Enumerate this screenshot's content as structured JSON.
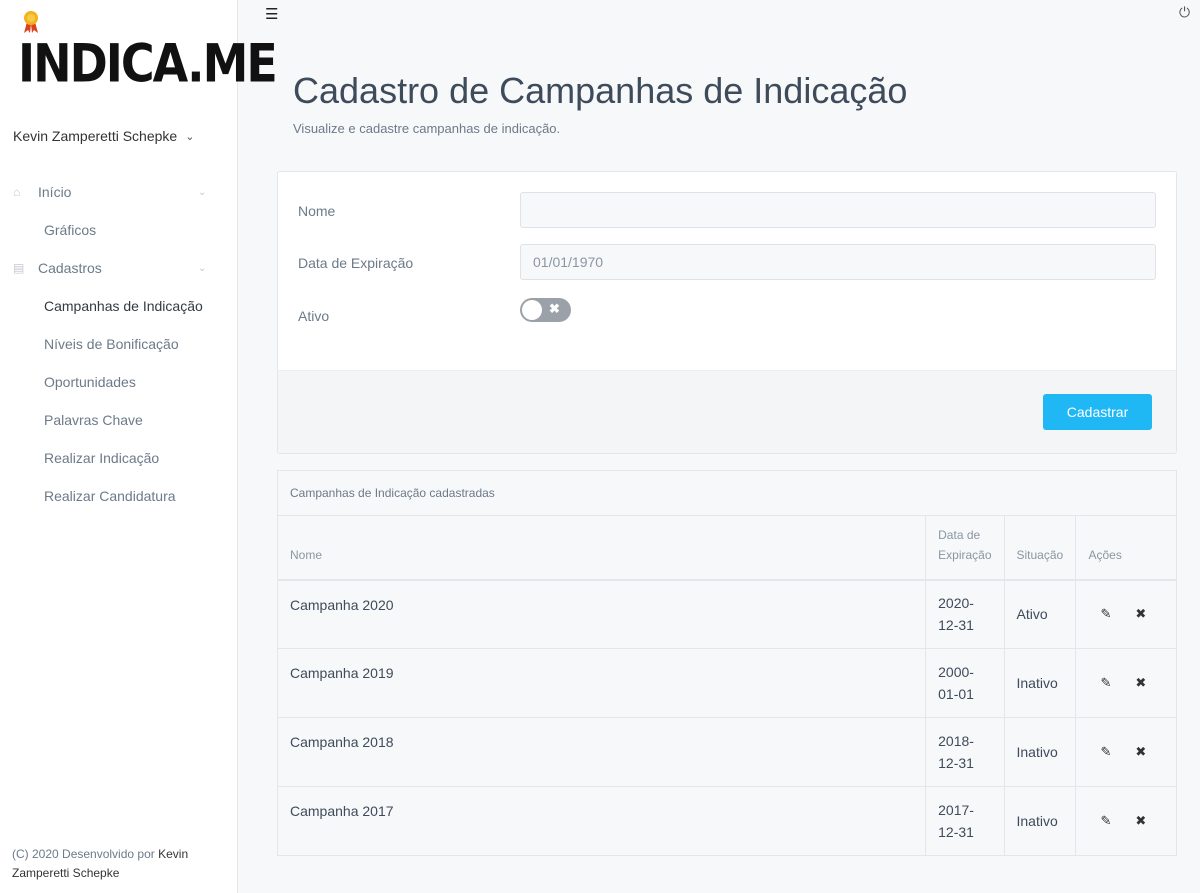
{
  "brand": {
    "logo_text": "INDICA.ME"
  },
  "user": {
    "name": "Kevin Zamperetti Schepke"
  },
  "sidebar": {
    "items": [
      {
        "label": "Início",
        "icon": "home-icon"
      },
      {
        "label": "Gráficos"
      },
      {
        "label": "Cadastros",
        "icon": "archive-icon"
      },
      {
        "label": "Campanhas de Indicação"
      },
      {
        "label": "Níveis de Bonificação"
      },
      {
        "label": "Oportunidades"
      },
      {
        "label": "Palavras Chave"
      },
      {
        "label": "Realizar Indicação"
      },
      {
        "label": "Realizar Candidatura"
      }
    ]
  },
  "footer": {
    "prefix": "(C) 2020 Desenvolvido por",
    "author": "Kevin Zamperetti Schepke"
  },
  "header": {
    "title": "Cadastro de Campanhas de Indicação",
    "subtitle": "Visualize e cadastre campanhas de indicação."
  },
  "form": {
    "name_label": "Nome",
    "name_value": "",
    "expiration_label": "Data de Expiração",
    "expiration_value": "01/01/1970",
    "active_label": "Ativo",
    "active": false,
    "submit_label": "Cadastrar"
  },
  "table": {
    "caption": "Campanhas de Indicação cadastradas",
    "columns": [
      "Nome",
      "Data de Expiração",
      "Situação",
      "Ações"
    ],
    "rows": [
      {
        "name": "Campanha 2020",
        "date": "2020-12-31",
        "status": "Ativo"
      },
      {
        "name": "Campanha 2019",
        "date": "2000-01-01",
        "status": "Inativo"
      },
      {
        "name": "Campanha 2018",
        "date": "2018-12-31",
        "status": "Inativo"
      },
      {
        "name": "Campanha 2017",
        "date": "2017-12-31",
        "status": "Inativo"
      }
    ]
  },
  "colors": {
    "accent": "#1fb8f5",
    "toggle_off": "#9aa1a9"
  }
}
